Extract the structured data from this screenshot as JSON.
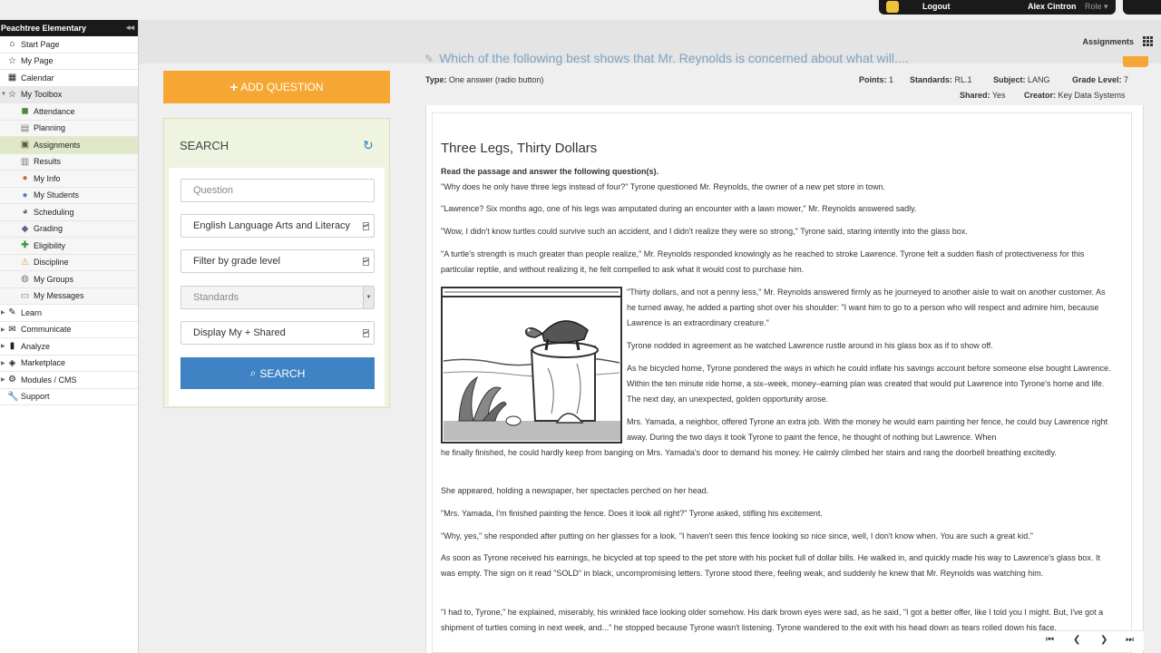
{
  "topbar": {
    "logout_label": "Logout",
    "user_name": "Alex Cintron",
    "role_label": "Role ▾"
  },
  "sidebar": {
    "school_name": "Peachtree Elementary",
    "items": [
      {
        "label": "Start Page",
        "icon": "home-icon"
      },
      {
        "label": "My Page",
        "icon": "star-icon"
      },
      {
        "label": "Calendar",
        "icon": "calendar-icon"
      },
      {
        "label": "My Toolbox",
        "icon": "star-icon"
      },
      {
        "label": "Attendance",
        "icon": "attendance-icon"
      },
      {
        "label": "Planning",
        "icon": "planning-icon"
      },
      {
        "label": "Assignments",
        "icon": "assignments-icon"
      },
      {
        "label": "Results",
        "icon": "results-icon"
      },
      {
        "label": "My Info",
        "icon": "user-icon"
      },
      {
        "label": "My Students",
        "icon": "students-icon"
      },
      {
        "label": "Scheduling",
        "icon": "scheduling-icon"
      },
      {
        "label": "Grading",
        "icon": "grading-icon"
      },
      {
        "label": "Eligibility",
        "icon": "plus-icon"
      },
      {
        "label": "Discipline",
        "icon": "warning-icon"
      },
      {
        "label": "My Groups",
        "icon": "groups-icon"
      },
      {
        "label": "My Messages",
        "icon": "messages-icon"
      },
      {
        "label": "Learn",
        "icon": "pencil-icon"
      },
      {
        "label": "Communicate",
        "icon": "chat-icon"
      },
      {
        "label": "Analyze",
        "icon": "bar-chart-icon"
      },
      {
        "label": "Marketplace",
        "icon": "tag-icon"
      },
      {
        "label": "Modules / CMS",
        "icon": "gear-icon"
      },
      {
        "label": "Support",
        "icon": "wrench-icon"
      }
    ]
  },
  "header": {
    "breadcrumb": "Assignments"
  },
  "left_panel": {
    "add_question_label": "ADD QUESTION",
    "search_title": "SEARCH",
    "question_placeholder": "Question",
    "subject_value": "English Language Arts and Literacy",
    "grade_value": "Filter by grade level",
    "standards_value": "Standards",
    "display_value": "Display My + Shared",
    "search_button_label": "SEARCH"
  },
  "question": {
    "title": "Which of the following best shows that Mr. Reynolds is concerned about what will....",
    "type_label": "Type:",
    "type_value": "One answer (radio button)",
    "points_label": "Points:",
    "points_value": "1",
    "standards_label": "Standards:",
    "standards_value": "RL.1",
    "subject_label": "Subject:",
    "subject_value": "LANG",
    "grade_label": "Grade Level:",
    "grade_value": "7",
    "shared_label": "Shared:",
    "shared_value": "Yes",
    "creator_label": "Creator:",
    "creator_value": "Key Data Systems"
  },
  "passage": {
    "title": "Three Legs, Thirty Dollars",
    "instruction": "Read the passage and answer the following question(s).",
    "p1": "\"Why does he only have three legs instead of four?\" Tyrone questioned Mr. Reynolds, the owner of a new pet store in town.",
    "p2": "\"Lawrence?  Six months ago, one of his legs was amputated during an encounter with a lawn mower,\" Mr. Reynolds answered sadly.",
    "p3": "\"Wow, I didn't know turtles could survive such an accident, and I didn't realize they were so strong,\" Tyrone said, staring intently into the glass box.",
    "p4": "\"A turtle's strength is much greater than people realize,\" Mr. Reynolds responded knowingly as he reached to stroke Lawrence.  Tyrone felt a sudden flash of protectiveness for this particular reptile, and without realizing it, he felt compelled to ask what it would cost to purchase him.",
    "p5": "\"Thirty dollars, and not a penny less,\" Mr. Reynolds answered firmly as he journeyed to another aisle to wait on another customer. As he turned away, he added a parting shot over his shoulder: \"I want him to go to a person who will respect and admire him, because Lawrence is an extraordinary creature.\"",
    "p6": "Tyrone nodded in agreement as he watched Lawrence rustle around in his glass box as if to show off.",
    "p7": "As he bicycled home, Tyrone pondered the ways in which he could inflate his savings account before someone else bought Lawrence.  Within the ten minute ride home, a six–week, money–earning plan was created that would put Lawrence into Tyrone's home and life.  The next day, an unexpected, golden opportunity arose.",
    "p8a": "Mrs. Yamada, a neighbor, offered Tyrone an extra job.  With the money he would earn painting her fence, he could buy Lawrence right away.  During the two days it took Tyrone to paint the fence, he thought of nothing but Lawrence.  When",
    "p8b": "he finally finished, he could hardly keep from banging on Mrs. Yamada's door to demand his money.  He calmly climbed her stairs and rang the doorbell breathing excitedly.",
    "p9": "She appeared, holding a newspaper, her spectacles perched on her head.",
    "p10": "\"Mrs. Yamada, I'm finished painting the fence.  Does it look all right?\" Tyrone asked, stifling his excitement.",
    "p11": "\"Why, yes,\" she responded after putting on her glasses for a look.  \"I haven't seen this fence looking so nice since, well, I don't know when.  You are such a great kid.\"",
    "p12": "As soon as Tyrone received his earnings, he bicycled at top speed to the pet store with his pocket full of dollar bills.  He walked in, and quickly made his way to Lawrence's glass box.  It was empty.  The sign on it read \"SOLD\" in black, uncompromising letters.  Tyrone stood there, feeling weak, and suddenly he knew that Mr. Reynolds was watching him.",
    "p13": "\"I had to, Tyrone,\" he explained, miserably, his wrinkled face looking older somehow.  His dark brown eyes were sad, as he said, \"I got a better offer, like I told you I might. But, I've got a shipment of turtles coming in next week, and...\" he stopped because Tyrone wasn't listening.  Tyrone wandered to the exit with his head down as tears rolled down his face."
  },
  "pager": {
    "first": "⏮",
    "prev": "❮",
    "next": "❯",
    "last": "⏭"
  },
  "colors": {
    "accent_orange": "#f6a733",
    "search_blue": "#3f83c4",
    "panel_green": "#eef4df",
    "active_nav": "#dfe9c8"
  }
}
